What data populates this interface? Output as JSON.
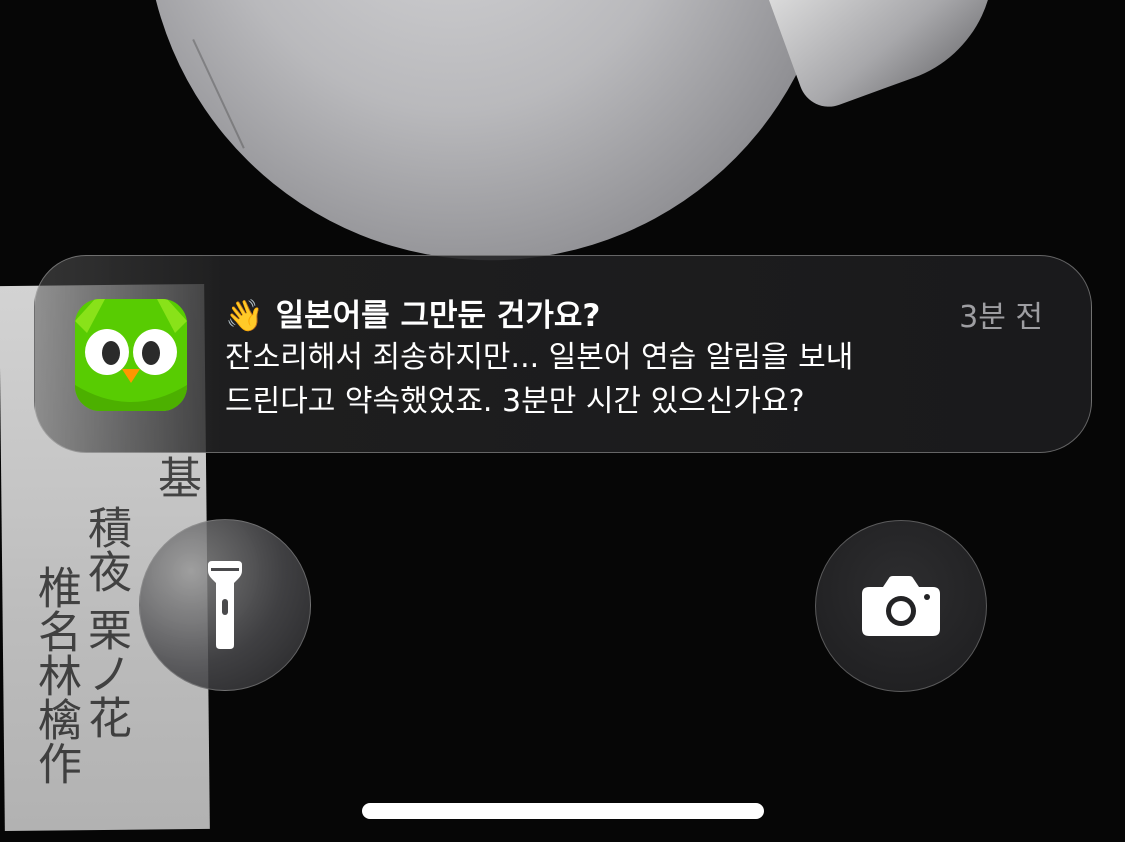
{
  "notification": {
    "app_icon": "duolingo-owl-icon",
    "title_emoji": "👋",
    "title": "일본어를 그만둔 건가요?",
    "time": "3분 전",
    "body_line1": "잔소리해서 죄송하지만... 일본어 연습 알림을 보내",
    "body_line2": "드린다고 약속했었죠. 3분만 시간 있으신가요?"
  },
  "wallpaper": {
    "card_text_1": "積夜 栗ノ花",
    "card_text_2": "椎名林檎作",
    "card_text_0": "基"
  },
  "buttons": {
    "flashlight_icon": "flashlight-icon",
    "camera_icon": "camera-icon"
  },
  "colors": {
    "duolingo_green": "#58cc02",
    "notification_bg": "#1c1c1e",
    "time_text": "#9e9ea2"
  }
}
